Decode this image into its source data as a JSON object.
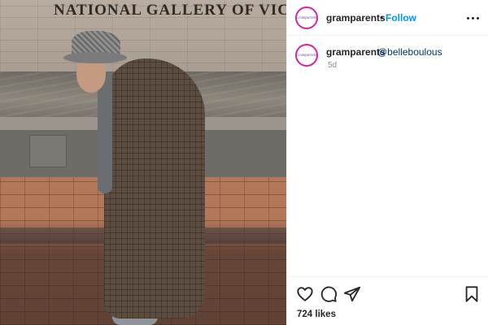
{
  "photo": {
    "sign_text": "NATIONAL GALLERY OF VIC"
  },
  "post": {
    "username": "gramparents",
    "avatar_text": "Gramparents",
    "separator": "•",
    "follow_label": "Follow",
    "more_icon": "more-horizontal-icon"
  },
  "comment": {
    "username": "gramparents",
    "mention": "@belleboulous",
    "time": "5d"
  },
  "actions": {
    "like_icon": "heart-icon",
    "comment_icon": "comment-icon",
    "share_icon": "send-icon",
    "save_icon": "bookmark-icon"
  },
  "likes": "724 likes",
  "colors": {
    "accent": "#0095f6",
    "text": "#262626",
    "muted": "#8e8e8e",
    "avatar_ring": "#d6249f"
  }
}
